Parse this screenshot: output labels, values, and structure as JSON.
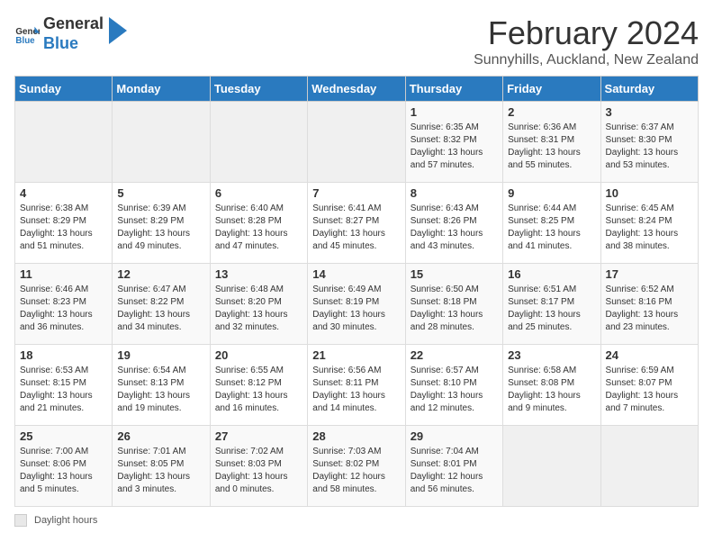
{
  "header": {
    "logo_general": "General",
    "logo_blue": "Blue",
    "month": "February 2024",
    "location": "Sunnyhills, Auckland, New Zealand"
  },
  "weekdays": [
    "Sunday",
    "Monday",
    "Tuesday",
    "Wednesday",
    "Thursday",
    "Friday",
    "Saturday"
  ],
  "weeks": [
    [
      {
        "day": "",
        "sunrise": "",
        "sunset": "",
        "daylight": "",
        "empty": true
      },
      {
        "day": "",
        "sunrise": "",
        "sunset": "",
        "daylight": "",
        "empty": true
      },
      {
        "day": "",
        "sunrise": "",
        "sunset": "",
        "daylight": "",
        "empty": true
      },
      {
        "day": "",
        "sunrise": "",
        "sunset": "",
        "daylight": "",
        "empty": true
      },
      {
        "day": "1",
        "sunrise": "Sunrise: 6:35 AM",
        "sunset": "Sunset: 8:32 PM",
        "daylight": "Daylight: 13 hours and 57 minutes."
      },
      {
        "day": "2",
        "sunrise": "Sunrise: 6:36 AM",
        "sunset": "Sunset: 8:31 PM",
        "daylight": "Daylight: 13 hours and 55 minutes."
      },
      {
        "day": "3",
        "sunrise": "Sunrise: 6:37 AM",
        "sunset": "Sunset: 8:30 PM",
        "daylight": "Daylight: 13 hours and 53 minutes."
      }
    ],
    [
      {
        "day": "4",
        "sunrise": "Sunrise: 6:38 AM",
        "sunset": "Sunset: 8:29 PM",
        "daylight": "Daylight: 13 hours and 51 minutes."
      },
      {
        "day": "5",
        "sunrise": "Sunrise: 6:39 AM",
        "sunset": "Sunset: 8:29 PM",
        "daylight": "Daylight: 13 hours and 49 minutes."
      },
      {
        "day": "6",
        "sunrise": "Sunrise: 6:40 AM",
        "sunset": "Sunset: 8:28 PM",
        "daylight": "Daylight: 13 hours and 47 minutes."
      },
      {
        "day": "7",
        "sunrise": "Sunrise: 6:41 AM",
        "sunset": "Sunset: 8:27 PM",
        "daylight": "Daylight: 13 hours and 45 minutes."
      },
      {
        "day": "8",
        "sunrise": "Sunrise: 6:43 AM",
        "sunset": "Sunset: 8:26 PM",
        "daylight": "Daylight: 13 hours and 43 minutes."
      },
      {
        "day": "9",
        "sunrise": "Sunrise: 6:44 AM",
        "sunset": "Sunset: 8:25 PM",
        "daylight": "Daylight: 13 hours and 41 minutes."
      },
      {
        "day": "10",
        "sunrise": "Sunrise: 6:45 AM",
        "sunset": "Sunset: 8:24 PM",
        "daylight": "Daylight: 13 hours and 38 minutes."
      }
    ],
    [
      {
        "day": "11",
        "sunrise": "Sunrise: 6:46 AM",
        "sunset": "Sunset: 8:23 PM",
        "daylight": "Daylight: 13 hours and 36 minutes."
      },
      {
        "day": "12",
        "sunrise": "Sunrise: 6:47 AM",
        "sunset": "Sunset: 8:22 PM",
        "daylight": "Daylight: 13 hours and 34 minutes."
      },
      {
        "day": "13",
        "sunrise": "Sunrise: 6:48 AM",
        "sunset": "Sunset: 8:20 PM",
        "daylight": "Daylight: 13 hours and 32 minutes."
      },
      {
        "day": "14",
        "sunrise": "Sunrise: 6:49 AM",
        "sunset": "Sunset: 8:19 PM",
        "daylight": "Daylight: 13 hours and 30 minutes."
      },
      {
        "day": "15",
        "sunrise": "Sunrise: 6:50 AM",
        "sunset": "Sunset: 8:18 PM",
        "daylight": "Daylight: 13 hours and 28 minutes."
      },
      {
        "day": "16",
        "sunrise": "Sunrise: 6:51 AM",
        "sunset": "Sunset: 8:17 PM",
        "daylight": "Daylight: 13 hours and 25 minutes."
      },
      {
        "day": "17",
        "sunrise": "Sunrise: 6:52 AM",
        "sunset": "Sunset: 8:16 PM",
        "daylight": "Daylight: 13 hours and 23 minutes."
      }
    ],
    [
      {
        "day": "18",
        "sunrise": "Sunrise: 6:53 AM",
        "sunset": "Sunset: 8:15 PM",
        "daylight": "Daylight: 13 hours and 21 minutes."
      },
      {
        "day": "19",
        "sunrise": "Sunrise: 6:54 AM",
        "sunset": "Sunset: 8:13 PM",
        "daylight": "Daylight: 13 hours and 19 minutes."
      },
      {
        "day": "20",
        "sunrise": "Sunrise: 6:55 AM",
        "sunset": "Sunset: 8:12 PM",
        "daylight": "Daylight: 13 hours and 16 minutes."
      },
      {
        "day": "21",
        "sunrise": "Sunrise: 6:56 AM",
        "sunset": "Sunset: 8:11 PM",
        "daylight": "Daylight: 13 hours and 14 minutes."
      },
      {
        "day": "22",
        "sunrise": "Sunrise: 6:57 AM",
        "sunset": "Sunset: 8:10 PM",
        "daylight": "Daylight: 13 hours and 12 minutes."
      },
      {
        "day": "23",
        "sunrise": "Sunrise: 6:58 AM",
        "sunset": "Sunset: 8:08 PM",
        "daylight": "Daylight: 13 hours and 9 minutes."
      },
      {
        "day": "24",
        "sunrise": "Sunrise: 6:59 AM",
        "sunset": "Sunset: 8:07 PM",
        "daylight": "Daylight: 13 hours and 7 minutes."
      }
    ],
    [
      {
        "day": "25",
        "sunrise": "Sunrise: 7:00 AM",
        "sunset": "Sunset: 8:06 PM",
        "daylight": "Daylight: 13 hours and 5 minutes."
      },
      {
        "day": "26",
        "sunrise": "Sunrise: 7:01 AM",
        "sunset": "Sunset: 8:05 PM",
        "daylight": "Daylight: 13 hours and 3 minutes."
      },
      {
        "day": "27",
        "sunrise": "Sunrise: 7:02 AM",
        "sunset": "Sunset: 8:03 PM",
        "daylight": "Daylight: 13 hours and 0 minutes."
      },
      {
        "day": "28",
        "sunrise": "Sunrise: 7:03 AM",
        "sunset": "Sunset: 8:02 PM",
        "daylight": "Daylight: 12 hours and 58 minutes."
      },
      {
        "day": "29",
        "sunrise": "Sunrise: 7:04 AM",
        "sunset": "Sunset: 8:01 PM",
        "daylight": "Daylight: 12 hours and 56 minutes."
      },
      {
        "day": "",
        "sunrise": "",
        "sunset": "",
        "daylight": "",
        "empty": true
      },
      {
        "day": "",
        "sunrise": "",
        "sunset": "",
        "daylight": "",
        "empty": true
      }
    ]
  ],
  "footer": {
    "label": "Daylight hours"
  }
}
